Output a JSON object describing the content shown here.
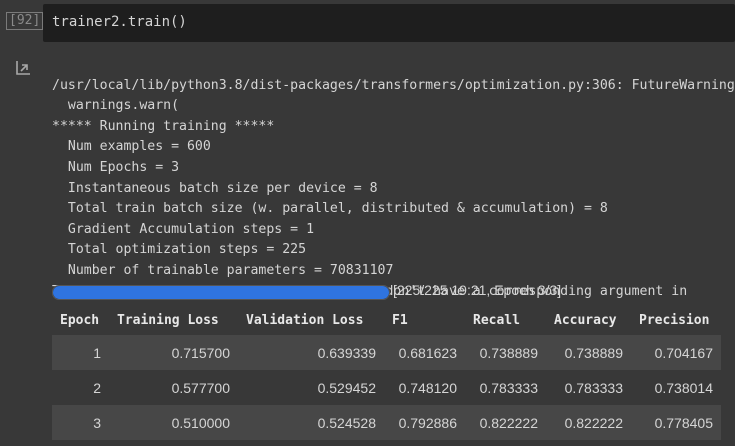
{
  "cell": {
    "exec_count": "[92]",
    "code": "trainer2.train()"
  },
  "output": {
    "icon": "output-redirect-icon",
    "lines": [
      "/usr/local/lib/python3.8/dist-packages/transformers/optimization.py:306: FutureWarning:",
      "  warnings.warn(",
      "***** Running training *****",
      "  Num examples = 600",
      "  Num Epochs = 3",
      "  Instantaneous batch size per device = 8",
      "  Total train batch size (w. parallel, distributed & accumulation) = 8",
      "  Gradient Accumulation steps = 1",
      "  Total optimization steps = 225",
      "  Number of trainable parameters = 70831107",
      "The following columns in the training set don't have a corresponding argument in"
    ],
    "progress": {
      "fraction": 1.0,
      "label": "[225/225 19:21, Epoch 3/3]"
    },
    "table": {
      "headers": [
        "Epoch",
        "Training Loss",
        "Validation Loss",
        "F1",
        "Recall",
        "Accuracy",
        "Precision"
      ],
      "rows": [
        [
          "1",
          "0.715700",
          "0.639339",
          "0.681623",
          "0.738889",
          "0.738889",
          "0.704167"
        ],
        [
          "2",
          "0.577700",
          "0.529452",
          "0.748120",
          "0.783333",
          "0.783333",
          "0.738014"
        ],
        [
          "3",
          "0.510000",
          "0.524528",
          "0.792886",
          "0.822222",
          "0.822222",
          "0.778405"
        ]
      ]
    }
  },
  "colors": {
    "background": "#383838",
    "code_background": "#1e1e1e",
    "progress_fill": "#2f74e0",
    "row_stripe": "#474747"
  }
}
